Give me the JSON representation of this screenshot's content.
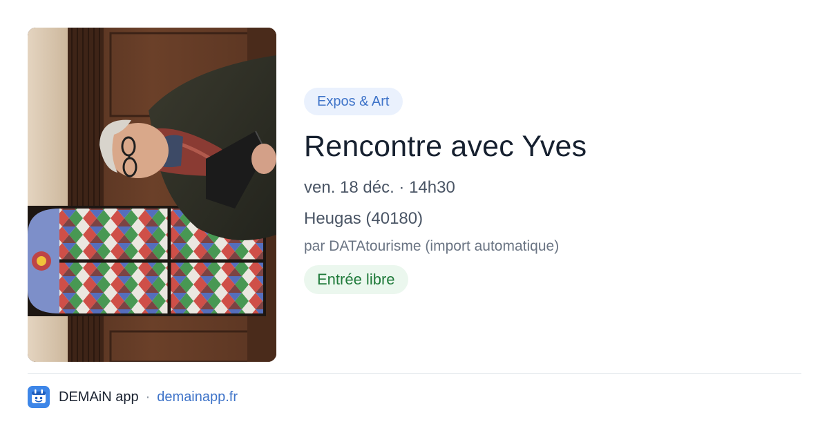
{
  "event": {
    "category": "Expos & Art",
    "title": "Rencontre avec Yves",
    "datetime": "ven. 18 déc. · 14h30",
    "location": "Heugas (40180)",
    "source": "par DATAtourisme (import automatique)",
    "price": "Entrée libre"
  },
  "footer": {
    "app_name": "DEMAiN app",
    "separator": "·",
    "url": "demainapp.fr"
  },
  "icons": {
    "app": "demain-app-logo-icon"
  },
  "colors": {
    "category_bg": "#eaf1fd",
    "category_text": "#3f74c9",
    "price_bg": "#ebf7ee",
    "price_text": "#1f7a3a",
    "title": "#16202f",
    "brand": "#3d86e8"
  }
}
